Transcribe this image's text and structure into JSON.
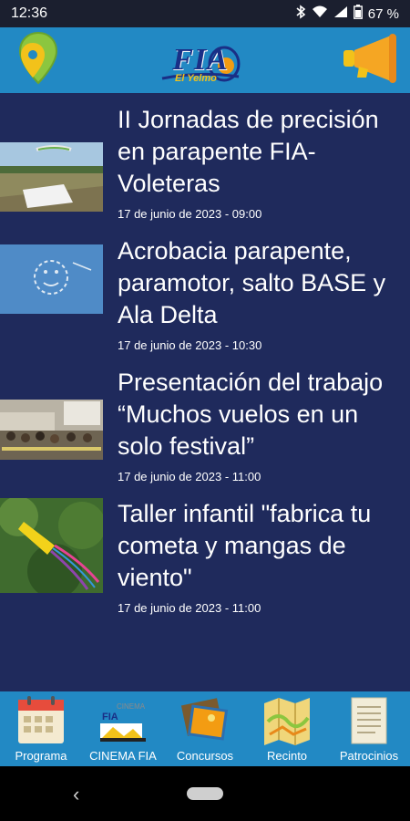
{
  "status_bar": {
    "time": "12:36",
    "battery": "67 %",
    "icons": [
      "bluetooth-icon",
      "wifi-icon",
      "signal-icon",
      "battery-icon"
    ]
  },
  "header": {
    "logo_text": "FIA",
    "logo_subtext": "El Yelmo",
    "left_icon": "map-pin-icon",
    "right_icon": "megaphone-icon"
  },
  "feed": {
    "items": [
      {
        "title": "II Jornadas de precisión en parapente FIA-Voleteras",
        "date": "17 de junio de 2023 - 09:00",
        "image": "paragliding-landing-photo"
      },
      {
        "title": "Acrobacia parapente, paramotor, salto BASE y Ala Delta",
        "date": "17 de junio de 2023 - 10:30",
        "image": "smoke-smiley-sky-photo"
      },
      {
        "title": "Presentación del trabajo “Muchos vuelos en un solo festival”",
        "date": "17 de junio de 2023 - 11:00",
        "image": "conference-audience-photo"
      },
      {
        "title": "Taller infantil \"fabrica tu cometa y mangas de viento\"",
        "date": "17 de junio de 2023 - 11:00",
        "image": "windsock-kite-photo"
      }
    ]
  },
  "tabs": [
    {
      "label": "Programa",
      "icon": "calendar-icon"
    },
    {
      "label": "CINEMA FIA",
      "icon": "cinema-icon"
    },
    {
      "label": "Concursos",
      "icon": "photos-icon"
    },
    {
      "label": "Recinto",
      "icon": "map-icon"
    },
    {
      "label": "Patrocinios",
      "icon": "document-icon"
    }
  ],
  "colors": {
    "header_bg": "#2289c4",
    "feed_bg": "#1f2a5c",
    "status_bg": "#1b1f2f",
    "nav_bg": "#000000",
    "text": "#ffffff"
  }
}
